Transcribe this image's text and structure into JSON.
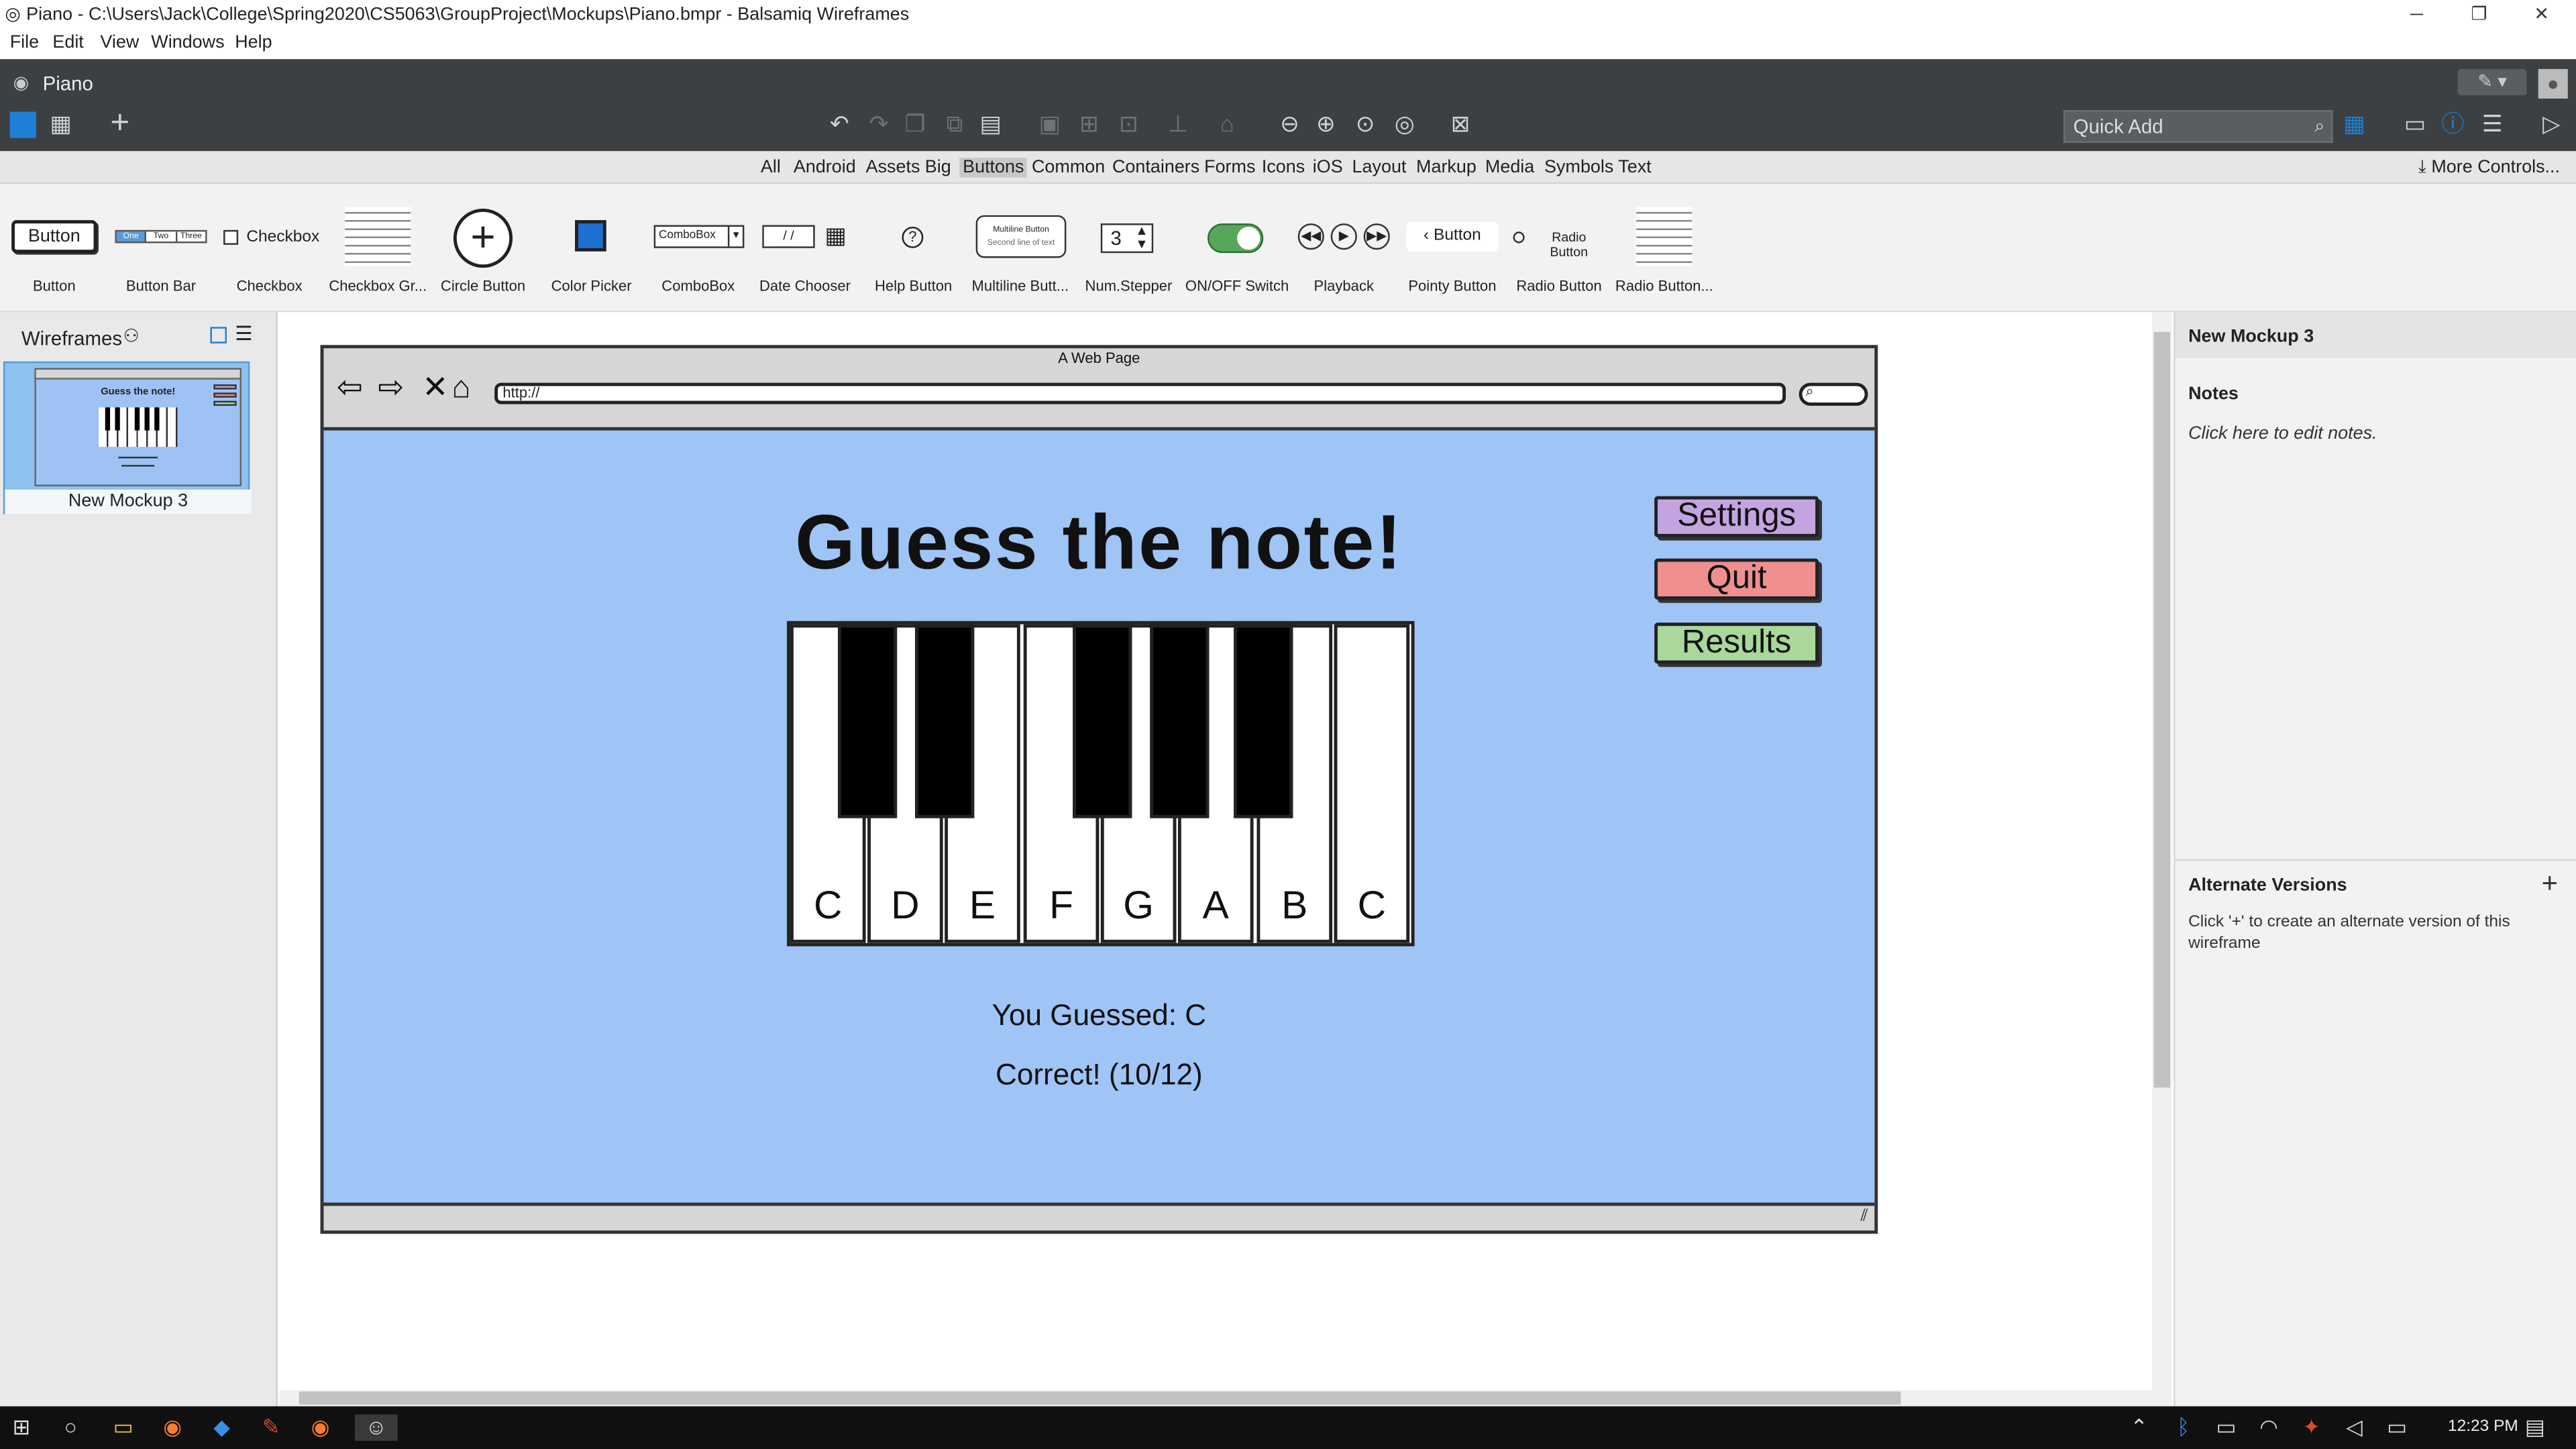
{
  "window": {
    "title": "Piano - C:\\Users\\Jack\\College\\Spring2020\\CS5063\\GroupProject\\Mockups\\Piano.bmpr - Balsamiq Wireframes",
    "controls": [
      "─",
      "❐",
      "✕"
    ]
  },
  "menu": [
    "File",
    "Edit",
    "View",
    "Windows",
    "Help"
  ],
  "document_title": "Piano",
  "quick_add": {
    "placeholder": "Quick Add"
  },
  "categories": [
    "All",
    "Android",
    "Assets",
    "Big",
    "Buttons",
    "Common",
    "Containers",
    "Forms",
    "Icons",
    "iOS",
    "Layout",
    "Markup",
    "Media",
    "Symbols",
    "Text"
  ],
  "active_category": "Buttons",
  "more_controls": "More Controls...",
  "components": [
    {
      "label": "Button",
      "preview": "Button"
    },
    {
      "label": "Button Bar",
      "preview": [
        "One",
        "Two",
        "Three"
      ]
    },
    {
      "label": "Checkbox",
      "preview": "Checkbox"
    },
    {
      "label": "Checkbox Gr..."
    },
    {
      "label": "Circle Button"
    },
    {
      "label": "Color Picker"
    },
    {
      "label": "ComboBox",
      "preview": "ComboBox"
    },
    {
      "label": "Date Chooser",
      "preview": "/ /"
    },
    {
      "label": "Help Button"
    },
    {
      "label": "Multiline Butt...",
      "preview": [
        "Multiline Button",
        "Second line of text"
      ]
    },
    {
      "label": "Num.Stepper",
      "preview": "3"
    },
    {
      "label": "ON/OFF Switch"
    },
    {
      "label": "Playback"
    },
    {
      "label": "Pointy Button",
      "preview": "Button"
    },
    {
      "label": "Radio Button",
      "preview": "Radio Button"
    },
    {
      "label": "Radio Button..."
    }
  ],
  "wireframes_panel": {
    "title": "Wireframes",
    "items": [
      {
        "label": "New Mockup 3"
      }
    ]
  },
  "mockup": {
    "window_title": "A Web Page",
    "url": "http://",
    "page_title": "Guess the note!",
    "buttons": {
      "settings": "Settings",
      "quit": "Quit",
      "results": "Results"
    },
    "white_keys": [
      "C",
      "D",
      "E",
      "F",
      "G",
      "A",
      "B",
      "C"
    ],
    "guessed_text": "You Guessed: C",
    "result_text": "Correct! (10/12)"
  },
  "right_panel": {
    "title": "New Mockup 3",
    "notes_title": "Notes",
    "notes_placeholder": "Click here to edit notes.",
    "alt_versions_title": "Alternate Versions",
    "alt_versions_desc": "Click '+' to create an alternate version of this wireframe"
  },
  "taskbar": {
    "time": "12:23 PM"
  },
  "colors": {
    "canvas_bg": "#9fc4f6",
    "settings_btn": "#c4a4e0",
    "quit_btn": "#ef8f8f",
    "results_btn": "#a9d89a",
    "toolbar_dark": "#3c4043",
    "accent_blue": "#1e7fd6"
  }
}
